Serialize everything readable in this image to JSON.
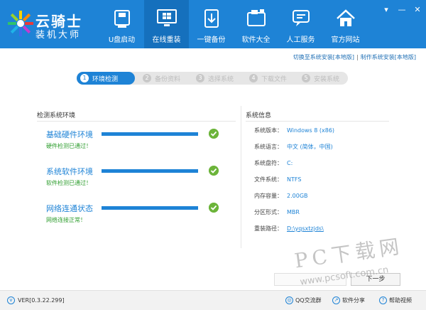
{
  "app": {
    "logo_title": "云骑士",
    "logo_subtitle": "装机大师"
  },
  "nav": [
    {
      "label": "U盘启动",
      "icon": "usb-drive-icon"
    },
    {
      "label": "在线重装",
      "icon": "windows-monitor-icon",
      "active": true
    },
    {
      "label": "一键备份",
      "icon": "backup-icon"
    },
    {
      "label": "软件大全",
      "icon": "software-folder-icon"
    },
    {
      "label": "人工服务",
      "icon": "chat-service-icon"
    },
    {
      "label": "官方网站",
      "icon": "home-icon"
    }
  ],
  "window_controls": {
    "menu": "▾",
    "minimize": "—",
    "close": "✕"
  },
  "top_links": {
    "switch": "切换至系统安装[本地版]",
    "separator": "|",
    "make": "制作系统安装[本地版]"
  },
  "steps": [
    {
      "num": "1",
      "label": "环境检测",
      "active": true
    },
    {
      "num": "2",
      "label": "备份资料"
    },
    {
      "num": "3",
      "label": "选择系统"
    },
    {
      "num": "4",
      "label": "下载文件"
    },
    {
      "num": "5",
      "label": "安装系统"
    }
  ],
  "detect": {
    "title": "检测系统环境",
    "items": [
      {
        "title": "基础硬件环境",
        "status": "硬件检测已通过！",
        "progress": 1.0
      },
      {
        "title": "系统软件环境",
        "status": "软件检测已通过！",
        "progress": 1.0
      },
      {
        "title": "网络连通状态",
        "status": "网络连接正常！",
        "progress": 1.0
      }
    ]
  },
  "sysinfo": {
    "title": "系统信息",
    "rows": [
      {
        "label": "系统版本：",
        "value": "Windows 8 (x86)"
      },
      {
        "label": "系统语言：",
        "value": "中文 (简体，中国)"
      },
      {
        "label": "系统盘符：",
        "value": "C:"
      },
      {
        "label": "文件系统：",
        "value": "NTFS"
      },
      {
        "label": "内存容量：",
        "value": "2.00GB"
      },
      {
        "label": "分区形式：",
        "value": "MBR"
      },
      {
        "label": "重装路径：",
        "value": "D:\\yqsxtzjds\\",
        "link": true
      }
    ]
  },
  "buttons": {
    "next": "下一步"
  },
  "footer": {
    "version": "VER[0.3.22.299]",
    "qq": "QQ交流群",
    "share": "软件分享",
    "help": "帮助视频"
  },
  "watermark": {
    "big": "PC下载网",
    "small": "www.pcsoft.com.cn"
  },
  "colors": {
    "header": "#1e83d6",
    "nav_active": "#1570bd",
    "accent": "#1e83d6",
    "ok_green": "#6cb43a",
    "status_green": "#2f9e2f"
  }
}
